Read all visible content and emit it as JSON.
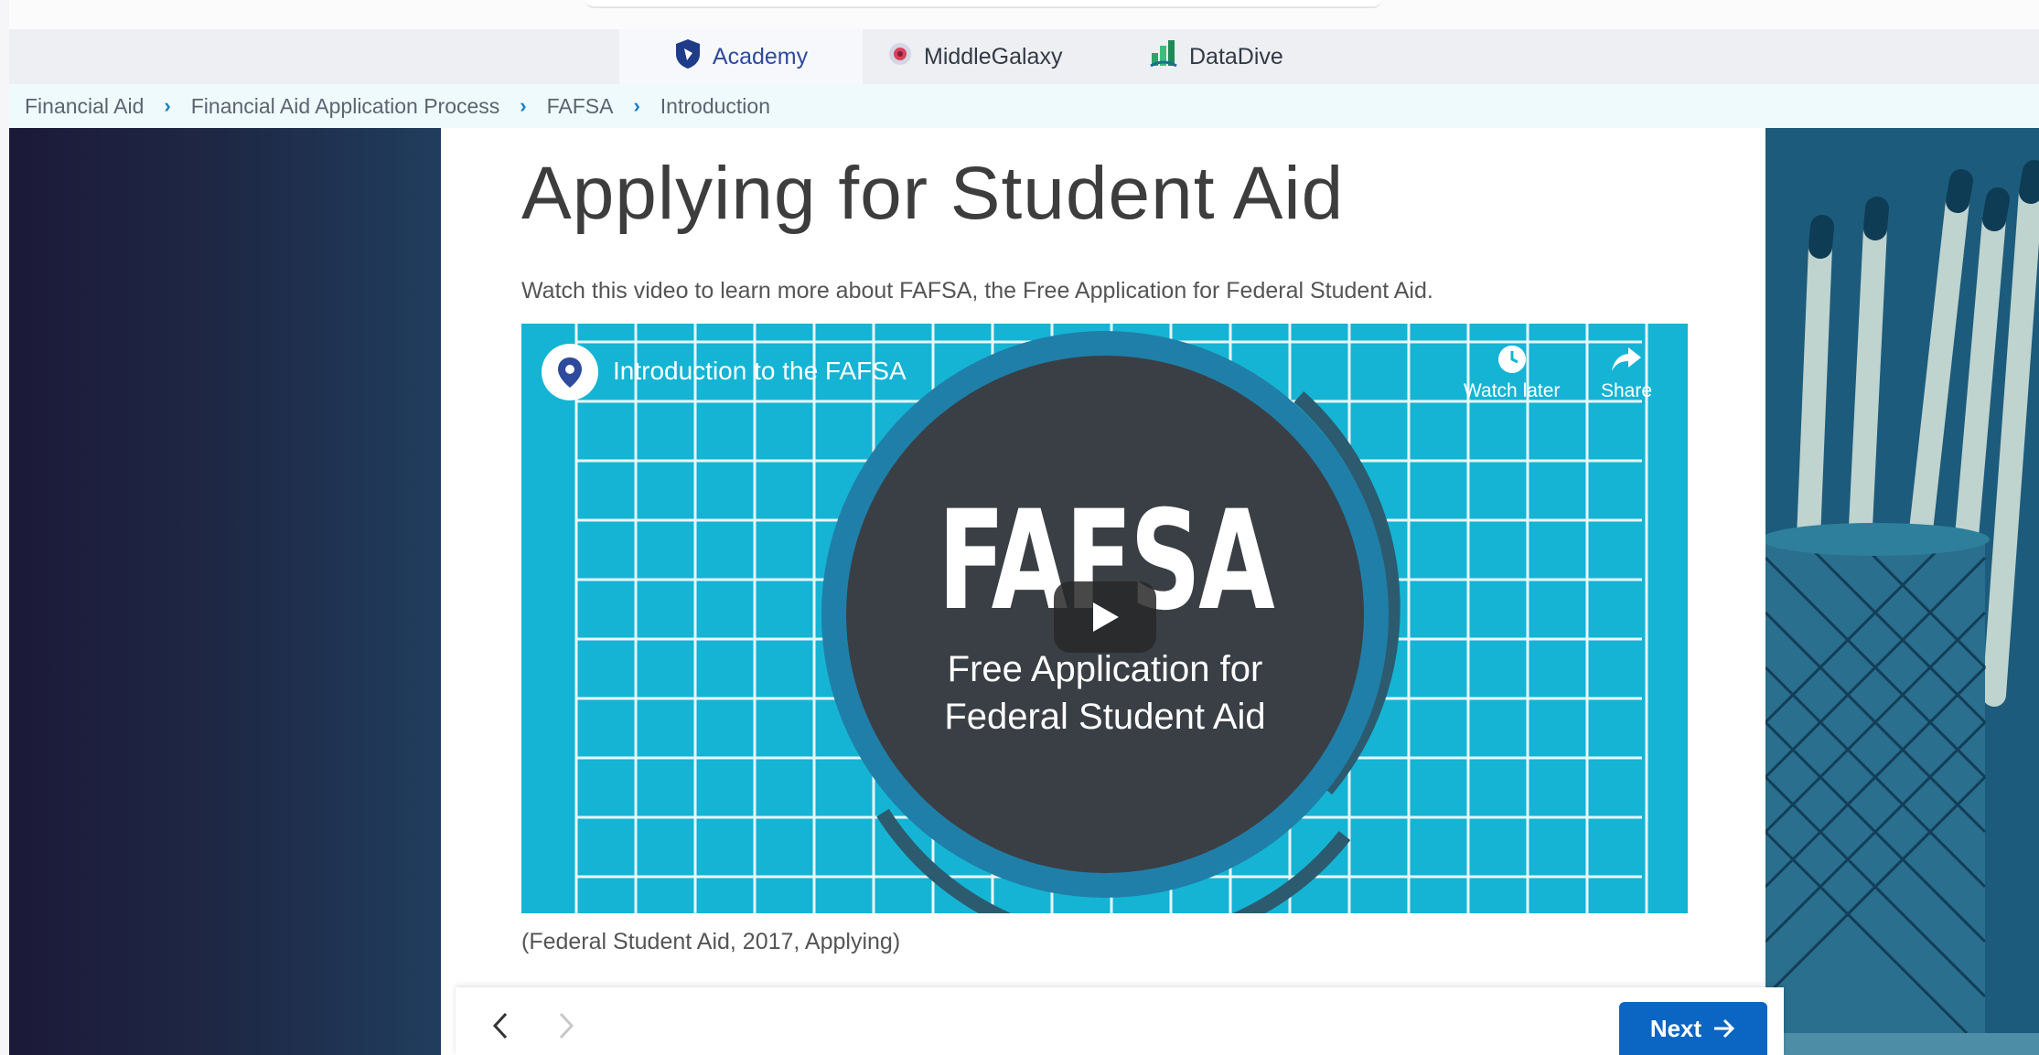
{
  "tabs": [
    {
      "label": "Academy",
      "icon": "academy-shield-icon",
      "active": true
    },
    {
      "label": "MiddleGalaxy",
      "icon": "middlegalaxy-logo-icon",
      "active": false
    },
    {
      "label": "DataDive",
      "icon": "datadive-logo-icon",
      "active": false
    }
  ],
  "breadcrumb": [
    "Financial Aid",
    "Financial Aid Application Process",
    "FAFSA",
    "Introduction"
  ],
  "main": {
    "title": "Applying for Student Aid",
    "intro": "Watch this video to learn more about FAFSA, the Free Application for Federal Student Aid.",
    "caption": "(Federal Student Aid, 2017, Applying)"
  },
  "video": {
    "title": "Introduction to the FAFSA",
    "watch_later": "Watch later",
    "share": "Share",
    "thumb_big": "FAFSA",
    "thumb_sub_1": "Free Application for",
    "thumb_sub_2": "Federal Student Aid"
  },
  "footer": {
    "next_label": "Next"
  },
  "colors": {
    "accent": "#0a66c2",
    "video_bg": "#15b4d4",
    "breadcrumb_sep": "#1a7fc4"
  }
}
